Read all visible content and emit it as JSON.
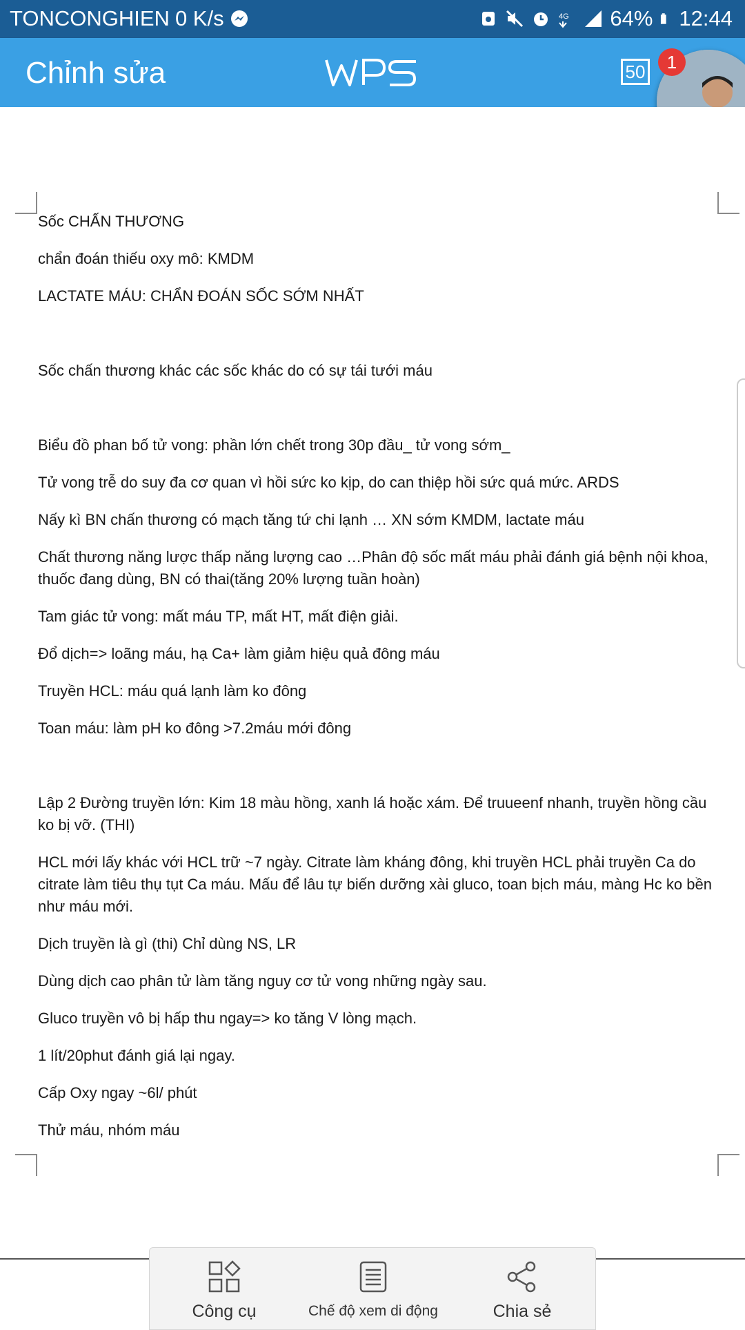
{
  "status_bar": {
    "carrier": "TONCONGHIEN",
    "speed": "0 K/s",
    "battery": "64%",
    "time": "12:44",
    "icons": [
      "messenger-icon",
      "nfc-icon",
      "mute-icon",
      "alarm-icon",
      "4g-icon",
      "signal-icon",
      "battery-icon"
    ]
  },
  "app_bar": {
    "title": "Chỉnh sửa",
    "logo": "WPS",
    "page_count": "50",
    "notification_badge": "1",
    "accent_color": "#3aa0e4"
  },
  "document": {
    "paragraphs": [
      "Sốc CHẤN THƯƠNG",
      "chẩn đoán thiếu oxy mô: KMDM",
      "LACTATE MÁU: CHẨN ĐOÁN SỐC SỚM NHẤT",
      "",
      "Sốc chấn thương khác các sốc khác do có sự tái tưới máu",
      "",
      "Biểu đồ phan bố tử vong: phần lớn chết trong 30p đầu_ tử vong sớm_",
      "Tử vong trễ do suy đa cơ quan vì hồi sức ko kịp, do can thiệp hồi sức quá mức. ARDS",
      "Nấy kì BN chấn thương có mạch tăng tứ chi lạnh … XN sớm KMDM, lactate máu",
      "Chất thương năng lược thấp năng lượng cao …Phân độ sốc mất máu phải đánh giá bệnh nội khoa, thuốc đang dùng, BN có thai(tăng 20% lượng tuần hoàn)",
      " Tam giác tử vong: mất máu TP, mất HT, mất điện giải.",
      "Đổ dịch=> loãng máu, hạ Ca+ làm giảm hiệu quả đông máu",
      "Truyền HCL: máu quá lạnh làm ko đông",
      "Toan máu: làm pH ko đông >7.2máu mới đông",
      "",
      "Lập 2 Đường truyền lớn: Kim 18 màu hồng, xanh lá hoặc xám. Để truueenf nhanh, truyền hồng cầu ko bị vỡ. (THI)",
      "HCL mới lấy khác với HCL trữ ~7 ngày. Citrate làm kháng đông, khi truyền HCL phải truyền Ca do citrate làm tiêu thụ tụt Ca máu. Mấu để lâu tự biến dưỡng xài gluco, toan bịch máu, màng Hc ko bền như máu mới.",
      "Dịch truyền là gì (thi) Chỉ dùng NS, LR",
      "Dùng dịch cao phân tử làm tăng nguy cơ tử vong những ngày sau.",
      "Gluco truyền vô bị hấp thu ngay=> ko tăng V lòng mạch.",
      "1 lít/20phut đánh giá lại ngay.",
      "Cấp Oxy ngay ~6l/ phút",
      "Thử máu, nhóm máu"
    ]
  },
  "toolbar": {
    "tools_label": "Công cụ",
    "mobile_view_label": "Chế độ xem di động",
    "share_label": "Chia sẻ"
  }
}
